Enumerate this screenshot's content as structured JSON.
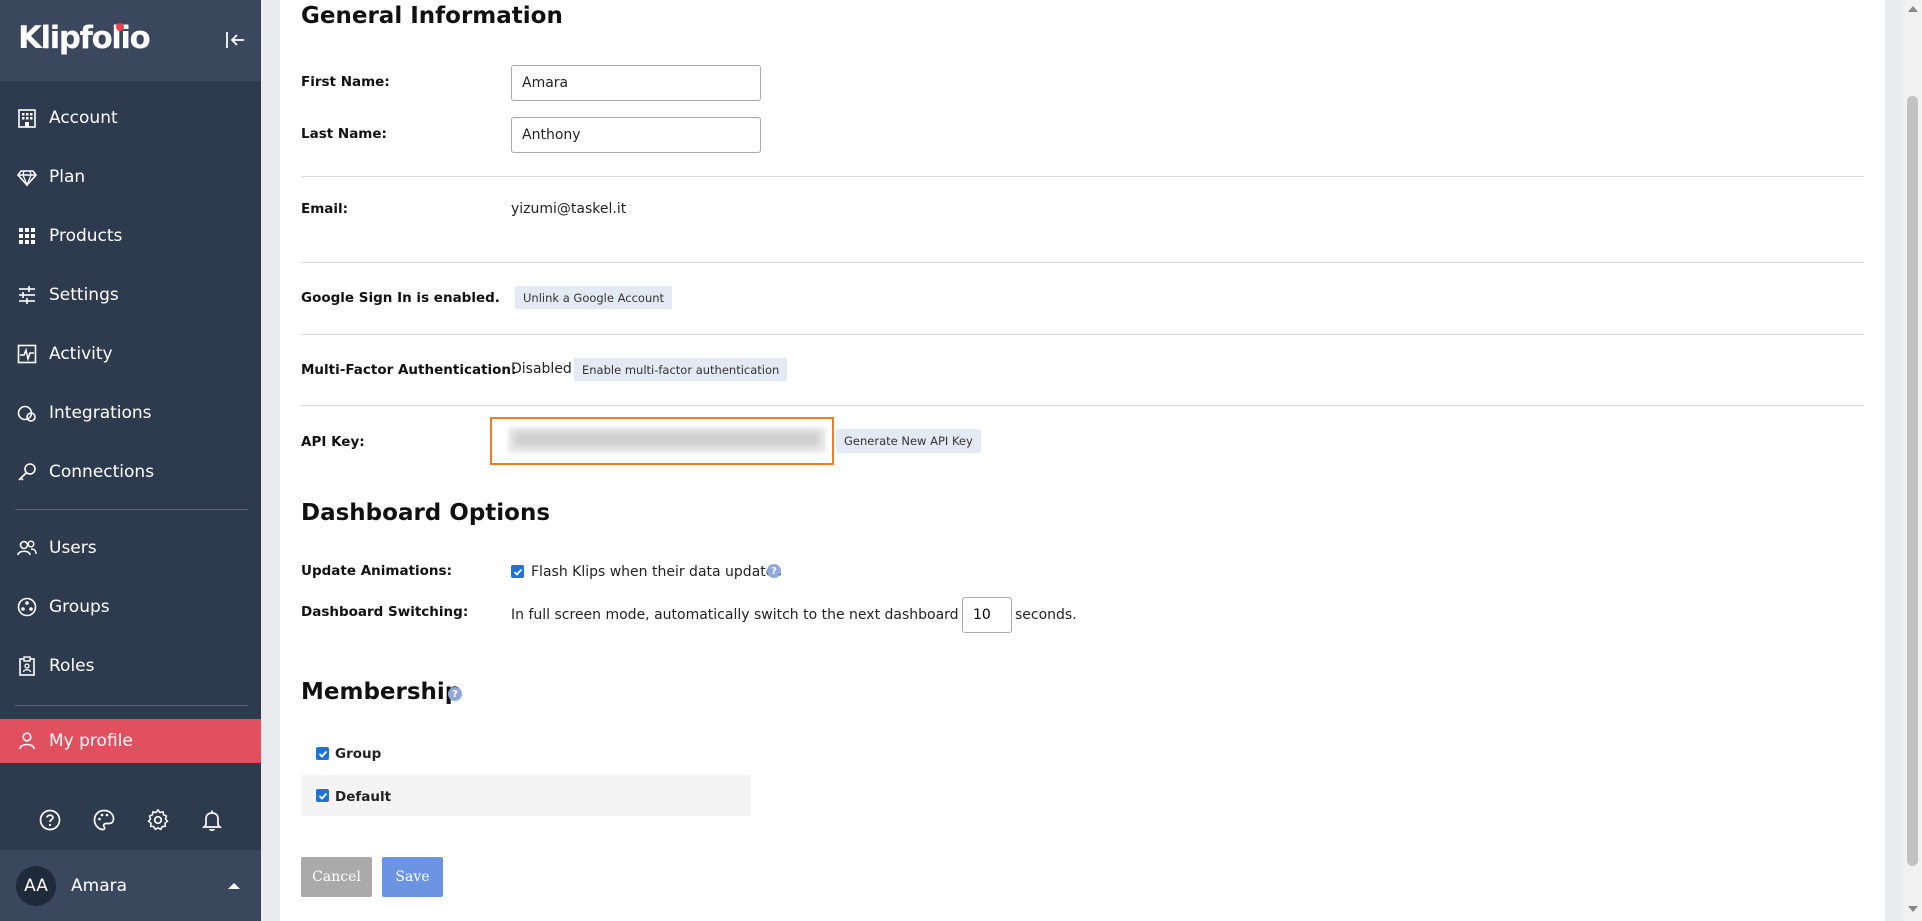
{
  "sidebar": {
    "logo": "Klipfolio",
    "collapse_icon": "collapse-left-icon",
    "items": [
      {
        "label": "Account",
        "icon": "building-icon"
      },
      {
        "label": "Plan",
        "icon": "diamond-icon"
      },
      {
        "label": "Products",
        "icon": "grid-icon"
      },
      {
        "label": "Settings",
        "icon": "sliders-icon"
      },
      {
        "label": "Activity",
        "icon": "activity-icon"
      },
      {
        "label": "Integrations",
        "icon": "integrations-icon"
      },
      {
        "label": "Connections",
        "icon": "key-icon"
      },
      {
        "label": "Users",
        "icon": "users-icon"
      },
      {
        "label": "Groups",
        "icon": "groups-icon"
      },
      {
        "label": "Roles",
        "icon": "clipboard-icon"
      },
      {
        "label": "My profile",
        "icon": "user-icon",
        "active": true
      }
    ],
    "bottom_icons": [
      "help-icon",
      "palette-icon",
      "gear-icon",
      "bell-icon"
    ],
    "user": {
      "initials": "AA",
      "name": "Amara"
    },
    "active_color": "#e0505e",
    "bg_color": "#2e3a4d"
  },
  "general": {
    "title": "General Information",
    "first_name_label": "First Name:",
    "first_name_value": "Amara",
    "last_name_label": "Last Name:",
    "last_name_value": "Anthony",
    "email_label": "Email:",
    "email_value": "yizumi@taskel.it",
    "google_label": "Google Sign In is enabled.",
    "google_button": "Unlink a Google Account",
    "mfa_label": "Multi-Factor Authentication:",
    "mfa_status": "Disabled",
    "mfa_button": "Enable multi-factor authentication",
    "api_label": "API Key:",
    "api_button": "Generate New API Key",
    "highlight_color": "#f07d26"
  },
  "dashboard": {
    "title": "Dashboard Options",
    "animations_label": "Update Animations:",
    "animations_option": "Flash Klips when their data updates",
    "switching_label": "Dashboard Switching:",
    "switching_prefix": "In full screen mode, automatically switch to the next dashboard every",
    "switching_value": "10",
    "switching_suffix": "seconds."
  },
  "membership": {
    "title": "Membership",
    "groups": [
      {
        "label": "Group",
        "checked": true
      },
      {
        "label": "Default",
        "checked": true
      }
    ]
  },
  "actions": {
    "cancel": "Cancel",
    "save": "Save",
    "save_color": "#6b95e3"
  }
}
